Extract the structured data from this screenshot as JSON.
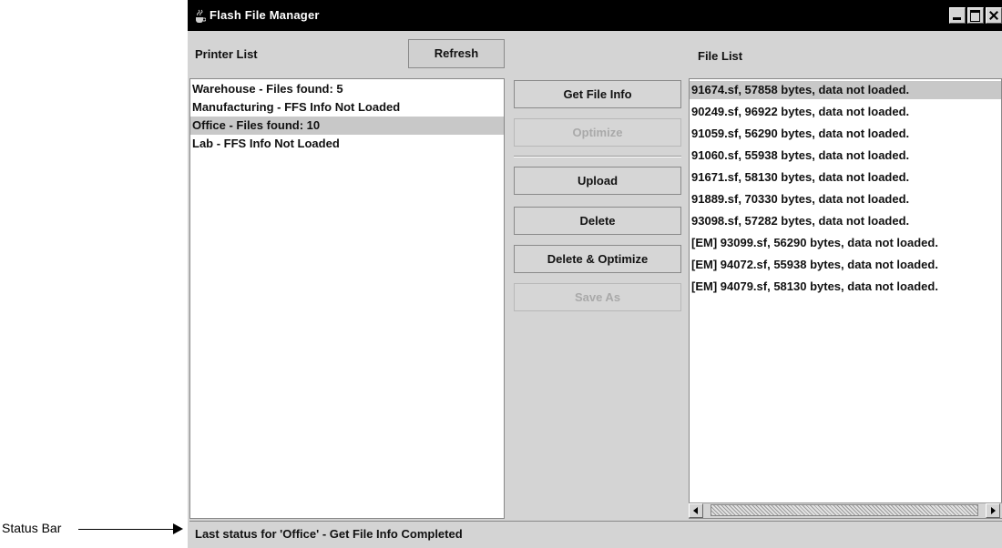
{
  "callout": {
    "label": "Status Bar"
  },
  "window": {
    "title": "Flash File Manager",
    "icon": "java-coffee-cup-icon"
  },
  "printer_list": {
    "label": "Printer List",
    "refresh_label": "Refresh",
    "items": [
      {
        "text": "Warehouse - Files found: 5",
        "selected": false
      },
      {
        "text": "Manufacturing - FFS Info Not Loaded",
        "selected": false
      },
      {
        "text": "Office - Files found: 10",
        "selected": true
      },
      {
        "text": "Lab - FFS Info Not Loaded",
        "selected": false
      }
    ]
  },
  "actions": {
    "get_file_info": "Get File Info",
    "optimize": "Optimize",
    "upload": "Upload",
    "delete": "Delete",
    "delete_optimize": "Delete & Optimize",
    "save_as": "Save As"
  },
  "file_list": {
    "label": "File List",
    "items": [
      {
        "text": "91674.sf, 57858 bytes, data not loaded.",
        "selected": true
      },
      {
        "text": "90249.sf, 96922 bytes, data not loaded.",
        "selected": false
      },
      {
        "text": "91059.sf, 56290 bytes, data not loaded.",
        "selected": false
      },
      {
        "text": "91060.sf, 55938 bytes, data not loaded.",
        "selected": false
      },
      {
        "text": "91671.sf, 58130 bytes, data not loaded.",
        "selected": false
      },
      {
        "text": "91889.sf, 70330 bytes, data not loaded.",
        "selected": false
      },
      {
        "text": "93098.sf, 57282 bytes, data not loaded.",
        "selected": false
      },
      {
        "text": "[EM] 93099.sf, 56290 bytes, data not loaded.",
        "selected": false
      },
      {
        "text": "[EM] 94072.sf, 55938 bytes, data not loaded.",
        "selected": false
      },
      {
        "text": "[EM] 94079.sf, 58130 bytes, data not loaded.",
        "selected": false
      }
    ]
  },
  "status": {
    "text": "Last status for 'Office' - Get File Info Completed"
  }
}
